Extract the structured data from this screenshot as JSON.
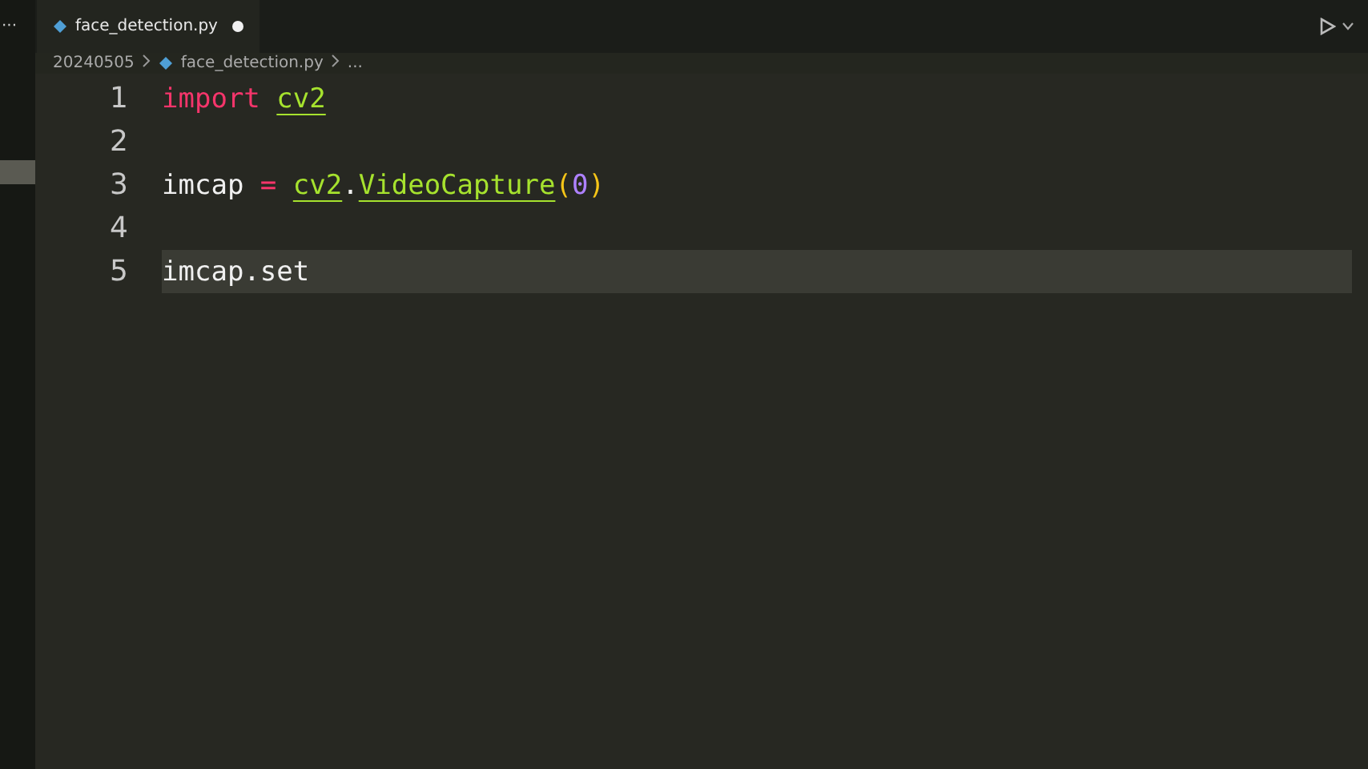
{
  "tabs": [
    {
      "label": "face_detection.py",
      "selected": true,
      "modified": true
    }
  ],
  "overflow": "···",
  "breadcrumb": [
    "20240505",
    "face_detection.py",
    "..."
  ],
  "lines": [
    {
      "number": "1",
      "current": false,
      "tokens": [
        {
          "kind": "keyword",
          "text": "import"
        },
        {
          "kind": "module",
          "text": "cv2",
          "space_before": true
        }
      ]
    },
    {
      "number": "2",
      "current": false
    },
    {
      "number": "3",
      "current": false,
      "tokens": [
        {
          "kind": "plain",
          "text": "imcap"
        },
        {
          "kind": "operator",
          "text": "=",
          "space_before": true
        },
        {
          "kind": "module",
          "text": "cv2",
          "space_before": true
        },
        {
          "kind": "plain",
          "text": "."
        },
        {
          "kind": "function",
          "text": "VideoCapture"
        },
        {
          "kind": "paren",
          "text": "("
        },
        {
          "kind": "number",
          "text": "0"
        },
        {
          "kind": "paren",
          "text": ")"
        }
      ]
    },
    {
      "number": "4",
      "current": false
    },
    {
      "number": "5",
      "current": true,
      "tokens": [
        {
          "kind": "plain",
          "text": "imcap.set"
        }
      ]
    }
  ]
}
